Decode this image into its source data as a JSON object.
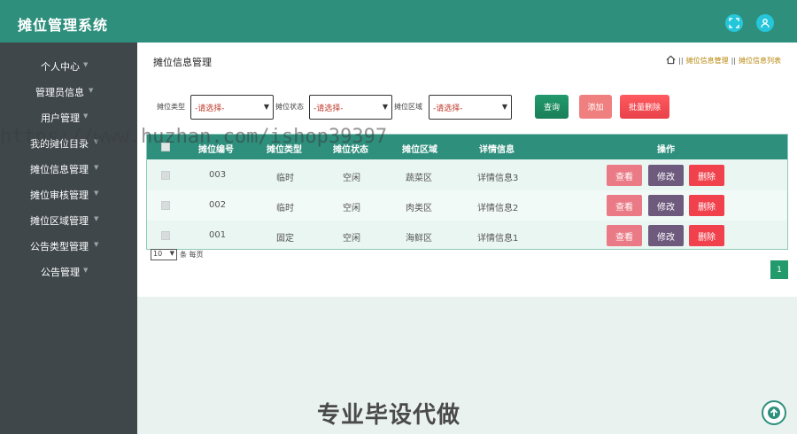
{
  "app": {
    "title": "摊位管理系统"
  },
  "header": {
    "icons": [
      "fullscreen-icon",
      "user-icon"
    ],
    "accent": "#2e8f7d"
  },
  "sidebar": {
    "items": [
      {
        "label": "个人中心"
      },
      {
        "label": "管理员信息"
      },
      {
        "label": "用户管理"
      },
      {
        "label": "我的摊位目录"
      },
      {
        "label": "摊位信息管理"
      },
      {
        "label": "摊位审核管理"
      },
      {
        "label": "摊位区域管理"
      },
      {
        "label": "公告类型管理"
      },
      {
        "label": "公告管理"
      }
    ]
  },
  "main": {
    "page_title": "摊位信息管理",
    "breadcrumb": [
      "摊位信息管理",
      "摊位信息列表"
    ],
    "filters": [
      {
        "label": "摊位类型",
        "value": "-请选择-"
      },
      {
        "label": "摊位状态",
        "value": "-请选择-"
      },
      {
        "label": "摊位区域",
        "value": "-请选择-"
      }
    ],
    "buttons": {
      "query": "查询",
      "add": "添加",
      "batch_delete": "批量删除"
    },
    "table": {
      "headers": [
        "摊位编号",
        "摊位类型",
        "摊位状态",
        "摊位区域",
        "详情信息",
        "操作"
      ],
      "rows": [
        {
          "code": "003",
          "type": "临时",
          "status": "空闲",
          "area": "蔬菜区",
          "detail": "详情信息3"
        },
        {
          "code": "002",
          "type": "临时",
          "status": "空闲",
          "area": "肉类区",
          "detail": "详情信息2"
        },
        {
          "code": "001",
          "type": "固定",
          "status": "空闲",
          "area": "海鲜区",
          "detail": "详情信息1"
        }
      ],
      "row_actions": {
        "view": "查看",
        "edit": "修改",
        "delete": "删除"
      }
    },
    "pager": {
      "page_size": "10",
      "per_page_label": "条 每页",
      "current_page": "1"
    }
  },
  "overlay": {
    "watermark": "https://www.huzhan.com/ishop39397",
    "bottom_text": "专业毕设代做"
  }
}
